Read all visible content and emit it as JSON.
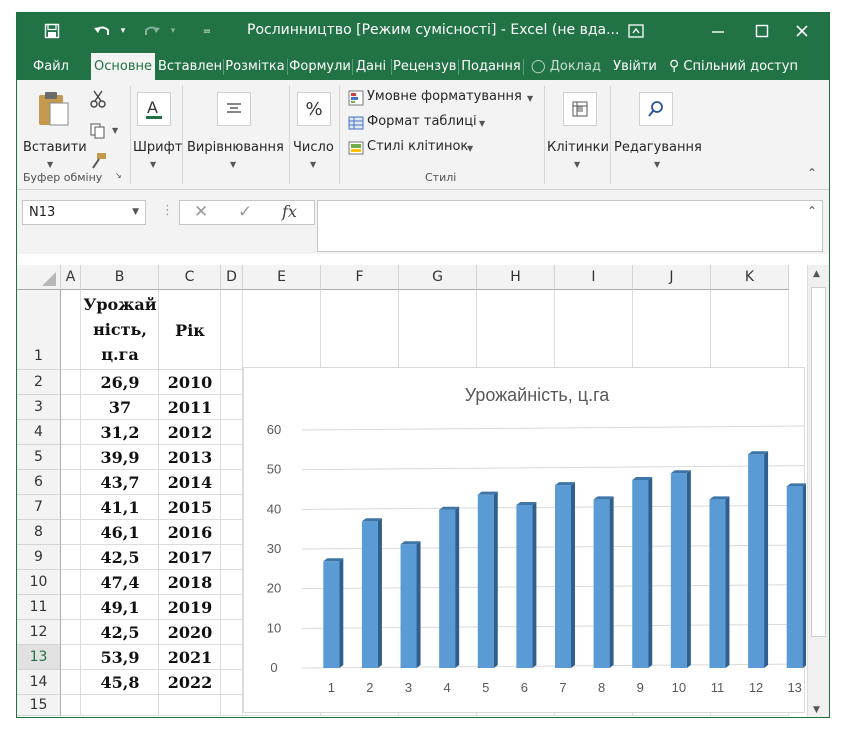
{
  "window": {
    "title": "Рослинництво  [Режим сумісності] - Excel (не вда...",
    "icons": [
      "save-icon",
      "undo-icon",
      "redo-icon",
      "qat-customize-icon",
      "ribbon-display-icon",
      "minimize-icon",
      "maximize-icon",
      "close-icon"
    ]
  },
  "tabs": [
    {
      "label": "Файл"
    },
    {
      "label": "Основне"
    },
    {
      "label": "Вставлення"
    },
    {
      "label": "Розмітка"
    },
    {
      "label": "Формули"
    },
    {
      "label": "Дані"
    },
    {
      "label": "Рецензування"
    },
    {
      "label": "Подання"
    }
  ],
  "tell_me": "Доклад",
  "sign_in": "Увійти",
  "share": "Спільний доступ",
  "ribbon": {
    "paste": "Вставити",
    "font": "Шрифт",
    "alignment": "Вирівнювання",
    "number": "Число",
    "cond_format": "Умовне форматування",
    "format_table": "Формат таблиці",
    "cell_styles": "Стилі клітинок",
    "cells": "Клітинки",
    "editing": "Редагування",
    "group_clipboard": "Буфер обміну",
    "group_styles": "Стилі"
  },
  "formula_bar": {
    "name_box": "N13",
    "fx": "fx",
    "formula": ""
  },
  "columns": [
    "A",
    "B",
    "C",
    "D",
    "E",
    "F",
    "G",
    "H",
    "I",
    "J",
    "K"
  ],
  "rows": [
    "1",
    "2",
    "3",
    "4",
    "5",
    "6",
    "7",
    "8",
    "9",
    "10",
    "11",
    "12",
    "13",
    "14",
    "15"
  ],
  "table": {
    "header_b": [
      "Урожай",
      "ність,",
      "ц.га"
    ],
    "header_c": "Рік",
    "values": [
      "26,9",
      "37",
      "31,2",
      "39,9",
      "43,7",
      "41,1",
      "46,1",
      "42,5",
      "47,4",
      "49,1",
      "42,5",
      "53,9",
      "45,8"
    ],
    "years": [
      "2010",
      "2011",
      "2012",
      "2013",
      "2014",
      "2015",
      "2016",
      "2017",
      "2018",
      "2019",
      "2020",
      "2021",
      "2022"
    ]
  },
  "chart_data": {
    "type": "bar",
    "title": "Урожайність, ц.га",
    "categories": [
      "1",
      "2",
      "3",
      "4",
      "5",
      "6",
      "7",
      "8",
      "9",
      "10",
      "11",
      "12",
      "13"
    ],
    "values": [
      26.9,
      37,
      31.2,
      39.9,
      43.7,
      41.1,
      46.1,
      42.5,
      47.4,
      49.1,
      42.5,
      53.9,
      45.8
    ],
    "ylim": [
      0,
      60
    ],
    "yticks": [
      "0",
      "10",
      "20",
      "30",
      "40",
      "50",
      "60"
    ],
    "grid": true,
    "legend": "none",
    "bar_color": "#5B9BD5",
    "bar_side_color": "#2E5F8E",
    "bar_top_color": "#3E75A8"
  },
  "colors": {
    "accent": "#217346"
  }
}
